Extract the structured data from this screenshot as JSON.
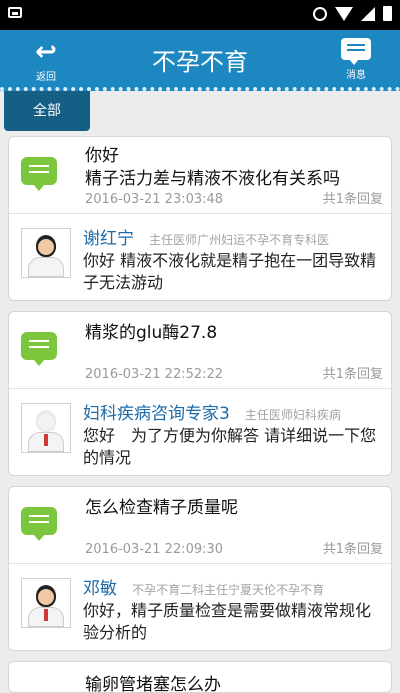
{
  "header": {
    "back_label": "返回",
    "title": "不孕不育",
    "message_label": "消息"
  },
  "filter": {
    "all_tab": "全部"
  },
  "items": [
    {
      "question_lines": [
        "你好",
        "精子活力差与精液不液化有关系吗"
      ],
      "date": "2016-03-21 23:03:48",
      "reply_count": "共1条回复",
      "doctor": "谢红宁",
      "doctor_title": "主任医师广州妇运不孕不育专科医",
      "answer": "你好 精液不液化就是精子抱在一团导致精子无法游动"
    },
    {
      "question_lines": [
        "精浆的glu酶27.8"
      ],
      "date": "2016-03-21 22:52:22",
      "reply_count": "共1条回复",
      "doctor": "妇科疾病咨询专家3",
      "doctor_title": "主任医师妇科疾病",
      "answer": "您好　为了方便为你解答 请详细说一下您的情况"
    },
    {
      "question_lines": [
        "怎么检查精子质量呢"
      ],
      "date": "2016-03-21 22:09:30",
      "reply_count": "共1条回复",
      "doctor": "邓敏",
      "doctor_title": "不孕不育二科主任宁夏天伦不孕不育",
      "answer": "你好，精子质量检查是需要做精液常规化验分析的"
    }
  ],
  "partial_item": {
    "question": "输卵管堵塞怎么办"
  },
  "icons": {
    "status_left": "image-notification-icon",
    "alarm": "alarm-icon",
    "wifi": "wifi-icon",
    "signal": "signal-icon",
    "battery": "battery-icon",
    "back": "back-arrow-icon",
    "message": "message-icon",
    "question": "chat-bubble-icon"
  },
  "colors": {
    "primary": "#1c87c1",
    "tab_active": "#155e86",
    "accent_green": "#7cc63e",
    "doctor_name": "#1c6aa8"
  }
}
